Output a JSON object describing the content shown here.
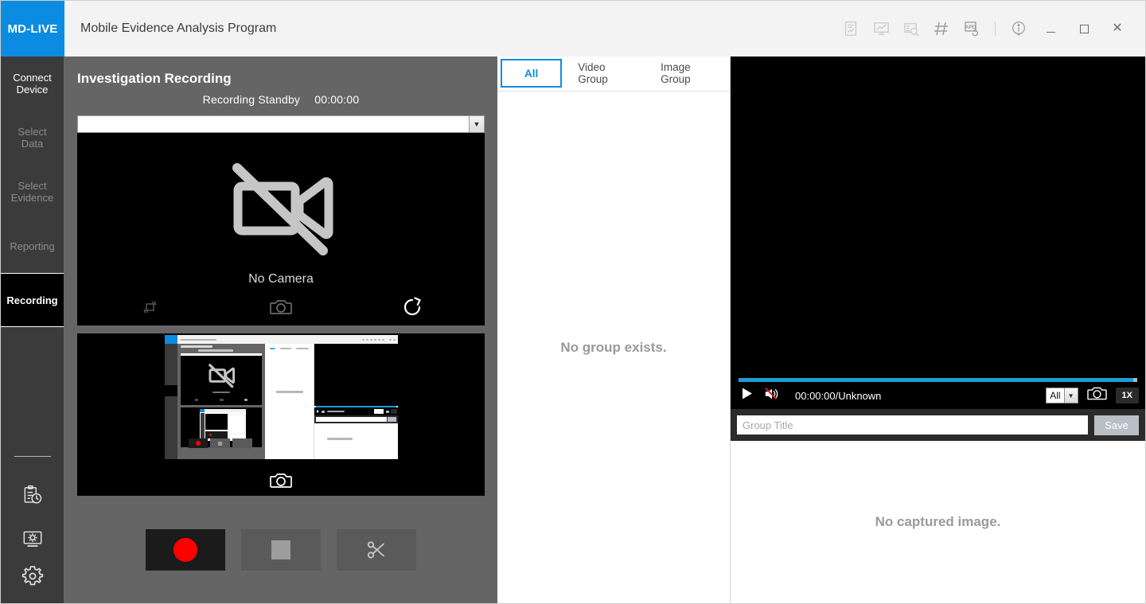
{
  "titlebar": {
    "brand": "MD-LIVE",
    "app_title": "Mobile Evidence Analysis Program",
    "icons": [
      {
        "name": "report-chart-icon",
        "label": "Report"
      },
      {
        "name": "monitor-chart-icon",
        "label": "Monitor"
      },
      {
        "name": "list-search-icon",
        "label": "Search List"
      },
      {
        "name": "hash-icon",
        "label": "Hash"
      },
      {
        "name": "apd-refresh-icon",
        "label": "APD"
      },
      {
        "name": "info-icon",
        "label": "Info"
      }
    ],
    "window_controls": {
      "minimize": "_",
      "maximize": "□",
      "close": "×"
    }
  },
  "sidebar": {
    "items": [
      {
        "label": "Connect Device",
        "state": "enabled"
      },
      {
        "label": "Select Data",
        "state": "disabled"
      },
      {
        "label": "Select Evidence",
        "state": "disabled"
      },
      {
        "label": "Reporting",
        "state": "disabled"
      },
      {
        "label": "Recording",
        "state": "active"
      }
    ],
    "bottom_icons": [
      {
        "name": "clipboard-clock-icon",
        "label": "History"
      },
      {
        "name": "monitor-gear-icon",
        "label": "Display Settings"
      },
      {
        "name": "gear-icon",
        "label": "Settings"
      }
    ]
  },
  "recording": {
    "title": "Investigation Recording",
    "status_label": "Recording Standby",
    "elapsed_time": "00:00:00",
    "camera_select_value": "",
    "camera_empty_label": "No Camera",
    "camera_actions": [
      {
        "name": "rotate-icon",
        "label": "Rotate"
      },
      {
        "name": "camera-capture-icon",
        "label": "Capture"
      },
      {
        "name": "refresh-icon",
        "label": "Refresh"
      }
    ],
    "screen_capture_icon": "camera-capture-icon",
    "controls": [
      {
        "name": "record-button",
        "label": "Record"
      },
      {
        "name": "stop-button",
        "label": "Stop"
      },
      {
        "name": "cut-button",
        "label": "Cut"
      }
    ]
  },
  "groups": {
    "tabs": [
      {
        "label": "All",
        "selected": true
      },
      {
        "label": "Video Group",
        "selected": false
      },
      {
        "label": "Image Group",
        "selected": false
      }
    ],
    "empty_message": "No group exists."
  },
  "player": {
    "progress_percent": 100,
    "play_label": "Play",
    "volume_state": "muted",
    "time": "00:00:00/Unknown",
    "filter_value": "All",
    "snapshot_icon": "camera-capture-icon",
    "speed": "1X",
    "group_title_placeholder": "Group Title",
    "group_title_value": "",
    "save_label": "Save",
    "captured_empty_message": "No captured image."
  },
  "colors": {
    "brand_blue": "#0b8ce0",
    "accent_blue": "#1d9bd7",
    "record_red": "#fe0000",
    "panel_gray": "#656565",
    "sidebar_gray": "#3b3b3b",
    "titlebar_gray": "#f3f3f3"
  }
}
